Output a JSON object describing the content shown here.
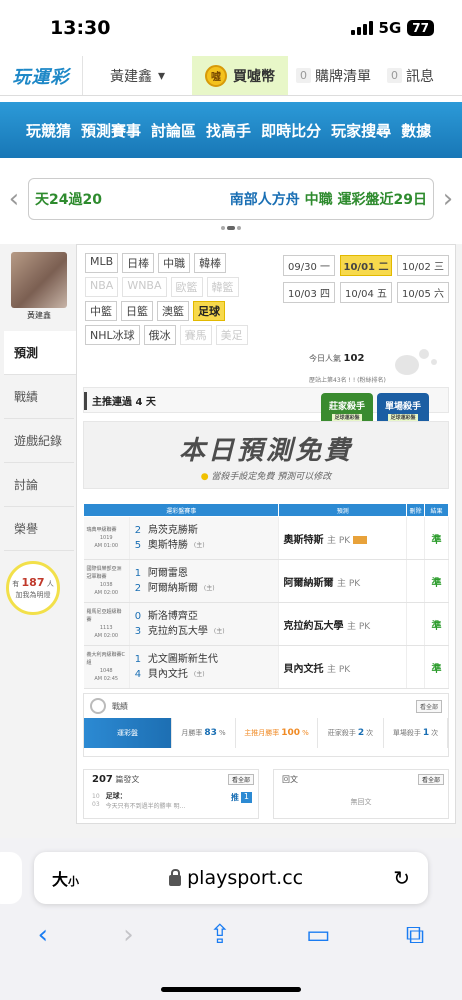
{
  "status": {
    "time": "13:30",
    "network": "5G",
    "battery": "77"
  },
  "topnav": {
    "logo": "玩運彩",
    "user": "黃建鑫",
    "buy": "買噓幣",
    "orders_count": "0",
    "orders": "購牌清單",
    "messages_count": "0",
    "messages": "訊息"
  },
  "menu": [
    "玩競猜",
    "預測賽事",
    "討論區",
    "找高手",
    "即時比分",
    "玩家搜尋",
    "數據"
  ],
  "marquee": {
    "left": "天24過20",
    "right1": "南部人方舟",
    "right2": "中職 運彩盤近29日"
  },
  "sidebar": {
    "name": "黃建鑫",
    "tabs": [
      "預測",
      "戰績",
      "遊戲紀錄",
      "討論",
      "榮譽"
    ],
    "helped_prefix": "有",
    "helped_count": "187",
    "helped_unit": "人",
    "helped_text": "加我為明燈"
  },
  "sports": [
    {
      "label": "MLB",
      "state": "normal"
    },
    {
      "label": "日棒",
      "state": "normal"
    },
    {
      "label": "中職",
      "state": "normal"
    },
    {
      "label": "韓棒",
      "state": "normal"
    },
    {
      "label": "NBA",
      "state": "dim"
    },
    {
      "label": "WNBA",
      "state": "dim"
    },
    {
      "label": "歐籃",
      "state": "dim"
    },
    {
      "label": "韓籃",
      "state": "dim"
    },
    {
      "label": "中籃",
      "state": "normal"
    },
    {
      "label": "日籃",
      "state": "normal"
    },
    {
      "label": "澳籃",
      "state": "normal"
    },
    {
      "label": "足球",
      "state": "sel"
    },
    {
      "label": "NHL冰球",
      "state": "normal"
    },
    {
      "label": "俄冰",
      "state": "normal"
    },
    {
      "label": "賽馬",
      "state": "dim"
    },
    {
      "label": "美足",
      "state": "dim"
    }
  ],
  "dates": [
    {
      "label": "09/30 一",
      "sel": false
    },
    {
      "label": "10/01 二",
      "sel": true
    },
    {
      "label": "10/02 三",
      "sel": false
    },
    {
      "label": "10/03 四",
      "sel": false
    },
    {
      "label": "10/04 五",
      "sel": false
    },
    {
      "label": "10/05 六",
      "sel": false
    }
  ],
  "popularity": {
    "label": "今日人氣",
    "value": "102",
    "rank": "歷站上第43名 ! ! (粉絲排名)"
  },
  "streak": "主推連過 4 天",
  "badges": [
    {
      "title": "莊家殺手",
      "sub": "足球運彩盤"
    },
    {
      "title": "單場殺手",
      "sub": "足球運彩盤"
    }
  ],
  "banner": {
    "title": "本日預測免費",
    "sub": "當殺手設定免費 預測可以修改"
  },
  "table": {
    "headers": [
      "運彩盤賽事",
      "預測",
      "刪除",
      "結果"
    ],
    "rows": [
      {
        "league": "瑞典甲級聯賽",
        "num": "1019",
        "time": "AM 01:00",
        "s1": "2",
        "t1": "烏茨克勝斯",
        "s2": "5",
        "t2": "奧斯特勝",
        "h": "(主)",
        "pick": "奧斯特斯",
        "pk": "主 PK",
        "hot": true,
        "result": "準"
      },
      {
        "league": "國際俱樂部亞洲冠軍聯賽",
        "num": "1038",
        "time": "AM 02:00",
        "s1": "1",
        "t1": "阿爾雷恩",
        "s2": "2",
        "t2": "阿爾納斯爾",
        "h": "(主)",
        "pick": "阿爾納斯爾",
        "pk": "主 PK",
        "hot": false,
        "result": "準"
      },
      {
        "league": "羅馬尼亞超級聯賽",
        "num": "1113",
        "time": "AM 02:00",
        "s1": "0",
        "t1": "斯洛博齊亞",
        "s2": "3",
        "t2": "克拉約瓦大學",
        "h": "(主)",
        "pick": "克拉約瓦大學",
        "pk": "主 PK",
        "hot": false,
        "result": "準"
      },
      {
        "league": "義大利丙級聯賽C組",
        "num": "1048",
        "time": "AM 02:45",
        "s1": "1",
        "t1": "尤文圖斯新生代",
        "s2": "4",
        "t2": "貝內文托",
        "h": "(主)",
        "pick": "貝內文托",
        "pk": "主 PK",
        "hot": false,
        "result": "準"
      }
    ]
  },
  "stats": {
    "title": "戰績",
    "more": "看全部",
    "items": [
      {
        "label": "運彩盤",
        "value": ""
      },
      {
        "label": "月勝率",
        "value": "83",
        "unit": "%"
      },
      {
        "label": "主推月勝率",
        "value": "100",
        "unit": "%"
      },
      {
        "label": "莊家殺手",
        "value": "2",
        "unit": "次"
      },
      {
        "label": "單場殺手",
        "value": "1",
        "unit": "次"
      }
    ]
  },
  "posts": {
    "count": "207",
    "label": "篇發文",
    "more": "看全部",
    "date_day": "10",
    "date_mon": "03",
    "post_cat": "足球：",
    "post_text": "今天只有不到過半的勝率 明...",
    "page_prefix": "推",
    "page": "1"
  },
  "replies": {
    "title": "回文",
    "more": "看全部",
    "empty": "無回文"
  },
  "safari": {
    "aa": "大",
    "aa_small": "小",
    "url": "playsport.cc"
  }
}
